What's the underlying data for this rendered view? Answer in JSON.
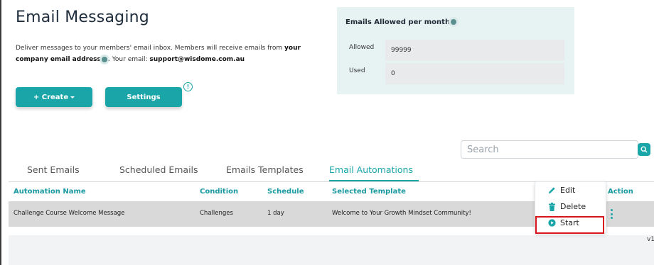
{
  "page": {
    "title": "Email Messaging",
    "description_part1": "Deliver messages to your members' email inbox. Members will receive emails from ",
    "description_bold1": "your company email address",
    "description_part2": ". Your email: ",
    "description_email": "support@wisdome.com.au"
  },
  "actions": {
    "create_label": "+ Create",
    "settings_label": "Settings",
    "info_glyph": "!"
  },
  "quota": {
    "title": "Emails Allowed per month",
    "allowed_label": "Allowed",
    "allowed_value": "99999",
    "used_label": "Used",
    "used_value": "0"
  },
  "search": {
    "placeholder": "Search"
  },
  "tabs": [
    {
      "label": "Sent Emails",
      "active": false
    },
    {
      "label": "Scheduled Emails",
      "active": false
    },
    {
      "label": "Emails Templates",
      "active": false
    },
    {
      "label": "Email Automations",
      "active": true
    }
  ],
  "table": {
    "headers": [
      "Automation Name",
      "Condition",
      "Schedule",
      "Selected Template",
      "Action"
    ],
    "rows": [
      {
        "automation_name": "Challenge Course Welcome Message",
        "condition": "Challenges",
        "schedule": "1 day",
        "selected_template": "Welcome to Your Growth Mindset Community!"
      }
    ]
  },
  "action_menu": {
    "items": [
      {
        "label": "Edit",
        "icon": "pencil-icon"
      },
      {
        "label": "Delete",
        "icon": "trash-icon"
      },
      {
        "label": "Start",
        "icon": "play-icon"
      }
    ]
  },
  "footer": {
    "version": "v1"
  },
  "colors": {
    "accent": "#1aa5a8",
    "panel_bg": "#e6f3f2",
    "row_bg": "#d9d9d9",
    "highlight": "#d9151b"
  }
}
